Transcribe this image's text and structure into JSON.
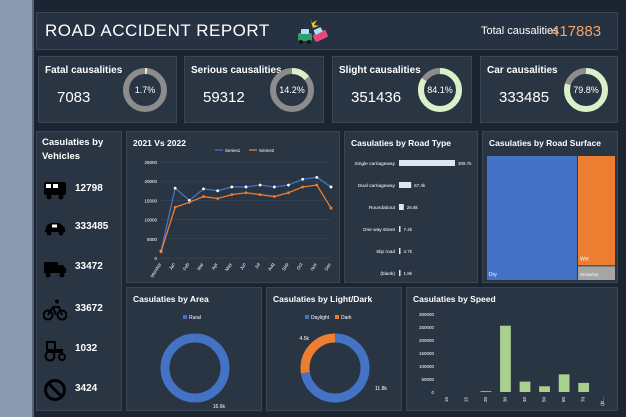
{
  "header": {
    "title": "ROAD ACCIDENT REPORT",
    "total_label": "Total causalities",
    "total_value": "417883"
  },
  "kpis": [
    {
      "label": "Fatal causalities",
      "value": "7083",
      "pct_label": "1.7%",
      "pct": 0.017
    },
    {
      "label": "Serious causalities",
      "value": "59312",
      "pct_label": "14.2%",
      "pct": 0.142
    },
    {
      "label": "Slight causalities",
      "value": "351436",
      "pct_label": "84.1%",
      "pct": 0.841
    },
    {
      "label": "Car causalities",
      "value": "333485",
      "pct_label": "79.8%",
      "pct": 0.798
    }
  ],
  "vehicles": {
    "title_line1": "Casulaties by",
    "title_line2": "Vehicles",
    "items": [
      {
        "icon": "bus-icon",
        "value": "12798"
      },
      {
        "icon": "car-icon",
        "value": "333485"
      },
      {
        "icon": "truck-icon",
        "value": "33472"
      },
      {
        "icon": "bicycle-icon",
        "value": "33672"
      },
      {
        "icon": "tractor-icon",
        "value": "1032"
      },
      {
        "icon": "no-entry-icon",
        "value": "3424"
      }
    ]
  },
  "colors": {
    "accent_orange": "#ed7d31",
    "accent_blue": "#4472c4",
    "ring_track": "#8c8c8c",
    "ring_fill": "#d9f0c8",
    "bar_green": "#a9d08e",
    "bar_light": "#dde6f3"
  },
  "chart_data": [
    {
      "type": "line",
      "title": "2021 Vs 2022",
      "categories": [
        "Monday",
        "Jan",
        "Feb",
        "Mar",
        "Apr",
        "May",
        "Jun",
        "Jul",
        "Aug",
        "Sep",
        "Oct",
        "Nov",
        "Dec"
      ],
      "series": [
        {
          "name": "Series1",
          "color": "#4472c4",
          "values": [
            1800,
            18200,
            15000,
            18000,
            17500,
            18500,
            18500,
            19000,
            18500,
            19000,
            20500,
            21000,
            18500
          ]
        },
        {
          "name": "Series2",
          "color": "#ed7d31",
          "values": [
            1600,
            13200,
            14500,
            16000,
            15500,
            16500,
            17000,
            16500,
            16000,
            17000,
            18500,
            19000,
            13000
          ]
        }
      ],
      "yticks": [
        "25000",
        "20000",
        "15000",
        "10000",
        "5000",
        "0"
      ],
      "ylim": [
        0,
        25000
      ]
    },
    {
      "type": "bar",
      "title": "Casulaties by Road Type",
      "categories": [
        "Single carriageway",
        "Dual carriageway",
        "Roundabout",
        "One way street",
        "Slip road",
        "(blank)"
      ],
      "values": [
        309.7,
        67.4,
        26.6,
        7.4,
        4.7,
        1.8
      ],
      "labels": [
        "309.7k",
        "67.4k",
        "26.6k",
        "7.4k",
        "4.7k",
        "1.8k"
      ]
    },
    {
      "type": "heatmap",
      "title": "Casulaties by Road Surface",
      "categories": [
        "Dry",
        "Wet",
        "Snow/Ice"
      ],
      "values": [
        279,
        105,
        13
      ],
      "colors": [
        "#4472c4",
        "#ed7d31",
        "#a5a5a5"
      ]
    },
    {
      "type": "pie",
      "title": "Casulaties by Area",
      "categories": [
        "Rural"
      ],
      "values": [
        16.6
      ],
      "labels": [
        "16.6k"
      ],
      "colors": [
        "#4472c4"
      ]
    },
    {
      "type": "pie",
      "title": "Casulaties by Light/Dark",
      "categories": [
        "Daylight",
        "Dark"
      ],
      "values": [
        11.8,
        4.5
      ],
      "labels": [
        "11.8k",
        "4.5k"
      ],
      "colors": [
        "#4472c4",
        "#ed7d31"
      ]
    },
    {
      "type": "bar",
      "title": "Casulaties by Speed",
      "categories": [
        "10",
        "15",
        "20",
        "30",
        "40",
        "50",
        "60",
        "70",
        "(bl..."
      ],
      "values": [
        0,
        0,
        3000,
        255000,
        40000,
        22000,
        68000,
        35000,
        0
      ],
      "yticks": [
        "300000",
        "250000",
        "200000",
        "150000",
        "100000",
        "50000",
        "0"
      ],
      "ylim": [
        0,
        300000
      ]
    }
  ]
}
